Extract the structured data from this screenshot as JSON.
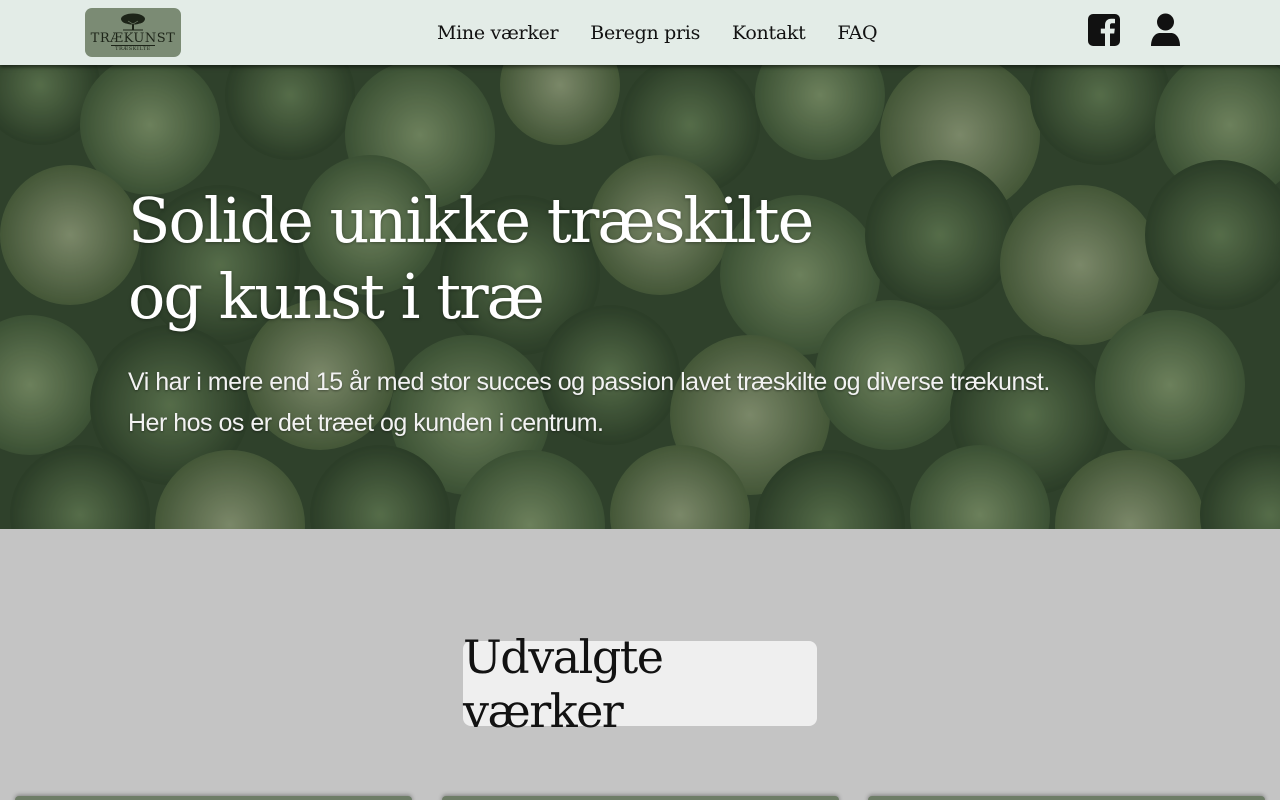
{
  "header": {
    "logo": {
      "title": "TRÆKUNST",
      "subtitle": "TRÆSKILTE"
    },
    "nav": [
      {
        "label": "Mine værker"
      },
      {
        "label": "Beregn pris"
      },
      {
        "label": "Kontakt"
      },
      {
        "label": "FAQ"
      }
    ],
    "icons": [
      "facebook-icon",
      "user-icon"
    ]
  },
  "hero": {
    "title": "Solide unikke træskilte og kunst i træ",
    "line1": "Vi har i mere end 15 år med stor succes og passion lavet træskilte og diverse trækunst.",
    "line2": "Her hos os er det træet og kunden i centrum."
  },
  "featured": {
    "heading": "Udvalgte værker"
  },
  "colors": {
    "header_bg": "#e3ece7",
    "logo_bg": "#7b8b74",
    "page_bg": "#c4c4c4",
    "heading_box": "#efefef",
    "card": "#6e7d67"
  }
}
